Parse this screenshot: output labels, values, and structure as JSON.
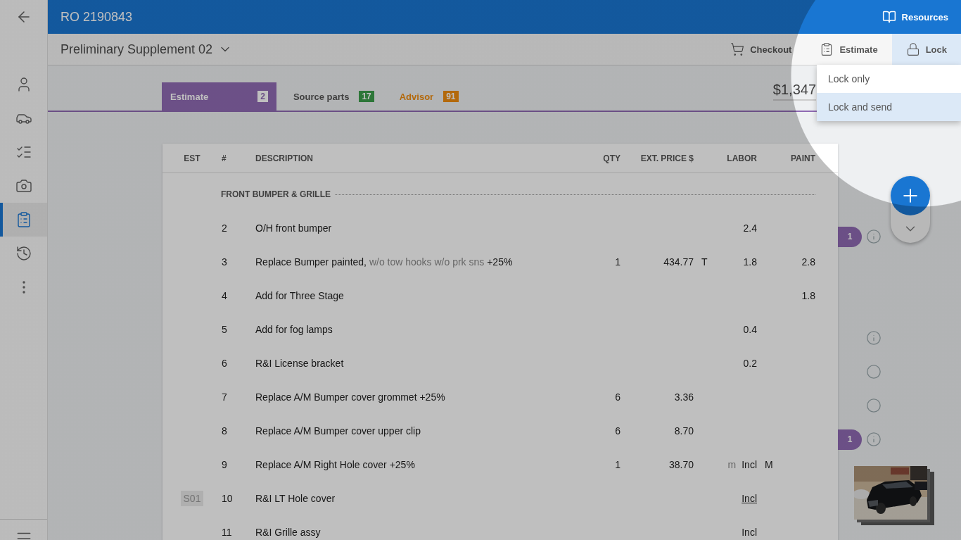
{
  "sidebar": {
    "items": [
      {
        "selected": false
      },
      {
        "selected": false
      },
      {
        "selected": false
      },
      {
        "selected": false
      },
      {
        "selected": true
      },
      {
        "selected": false
      },
      {
        "selected": false
      }
    ]
  },
  "header": {
    "title": "RO 2190843",
    "resources": "Resources"
  },
  "toolbar": {
    "title": "Preliminary Supplement 02",
    "actions": [
      {
        "label": "Checkout",
        "selected": false
      },
      {
        "label": "Estimate",
        "selected": false
      },
      {
        "label": "Lock",
        "selected": true
      }
    ]
  },
  "menu": {
    "items": [
      {
        "label": "Lock only",
        "selected": false
      },
      {
        "label": "Lock and send",
        "selected": true
      }
    ]
  },
  "tabs": [
    {
      "label": "Estimate",
      "count": "2",
      "selected": true,
      "accent_label": false,
      "color": "#6c5087"
    },
    {
      "label": "Source parts",
      "count": "17",
      "selected": false,
      "accent_label": false,
      "color": "#2d7638"
    },
    {
      "label": "Advisor",
      "count": "91",
      "selected": false,
      "accent_label": true,
      "color": "#b3690c"
    }
  ],
  "total": "$1,347",
  "table": {
    "columns": [
      "EST",
      "#",
      "DESCRIPTION",
      "QTY",
      "EXT. PRICE $",
      "LABOR",
      "PAINT"
    ],
    "group": "FRONT BUMPER & GRILLE",
    "rows": [
      {
        "num": "2",
        "description": "O/H front bumper",
        "labor": "2.4",
        "marker": {
          "kind": "count",
          "count": "1"
        }
      },
      {
        "num": "3",
        "description": "Replace Bumper painted,",
        "note": "w/o tow hooks w/o prk sns",
        "suffix": "+25%",
        "qty": "1",
        "price": "434.77",
        "price_flag": "T",
        "labor": "1.8",
        "paint": "2.8"
      },
      {
        "num": "4",
        "description": "Add for Three Stage",
        "paint": "1.8"
      },
      {
        "num": "5",
        "description": "Add for fog lamps",
        "labor": "0.4",
        "marker": {
          "kind": "info"
        }
      },
      {
        "num": "6",
        "description": "R&I License bracket",
        "labor": "0.2",
        "marker": {
          "kind": "circle"
        }
      },
      {
        "num": "7",
        "description": "Replace A/M Bumper cover grommet +25%",
        "qty": "6",
        "price": "3.36",
        "marker": {
          "kind": "circle"
        }
      },
      {
        "num": "8",
        "description": "Replace A/M Bumper cover upper clip",
        "qty": "6",
        "price": "8.70",
        "marker": {
          "kind": "count",
          "count": "1"
        }
      },
      {
        "num": "9",
        "description": "Replace A/M Right Hole cover +25%",
        "qty": "1",
        "price": "38.70",
        "labor_prefix": "m",
        "labor": "Incl",
        "labor_flag": "M"
      },
      {
        "num": "10",
        "est": "S01",
        "description": "R&I LT Hole cover",
        "labor": "Incl",
        "labor_underlined": true
      },
      {
        "num": "11",
        "description": "R&I Grille assy",
        "labor": "Incl"
      }
    ]
  }
}
